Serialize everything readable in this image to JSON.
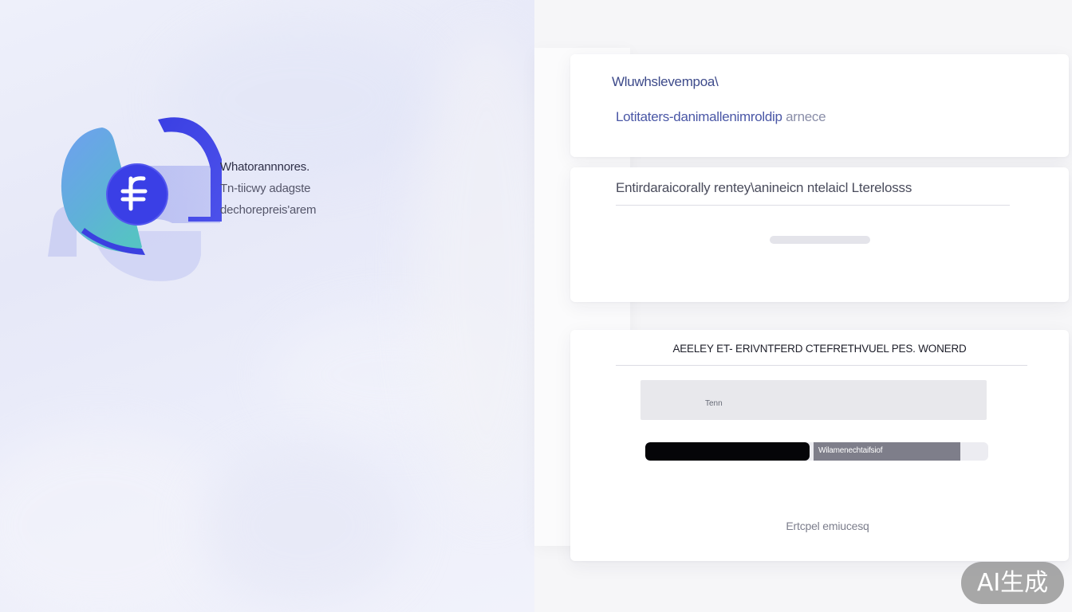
{
  "hero": {
    "line1": "Whatorannnores.",
    "line2": "Tn-tiicwy adagste",
    "line3": "dechorepreis'arem",
    "logo_icon": "currency-bubble-icon",
    "accent": "#4a4fe6",
    "accent_light": "#6ea7e8"
  },
  "card1": {
    "title": "Wluwhslevempoa\\",
    "subtitle": "Lotitaters-danimallenimroldip",
    "subtitle_muted": "arnece"
  },
  "card2": {
    "heading": "Entirdaraicorally rentey\\anineicn ntelaicl Lterelosss"
  },
  "card3": {
    "heading": "AEELEY ET- ERIVNTFERD CTEFRETHVUEL PES. WONERD",
    "field_label": "Tenn",
    "progress_label": "Wilamenechtaifsiof",
    "progress_fraction": 0.48,
    "footer_link": "Ertcpel emiucesq"
  },
  "watermark": {
    "text": "AI生成"
  }
}
